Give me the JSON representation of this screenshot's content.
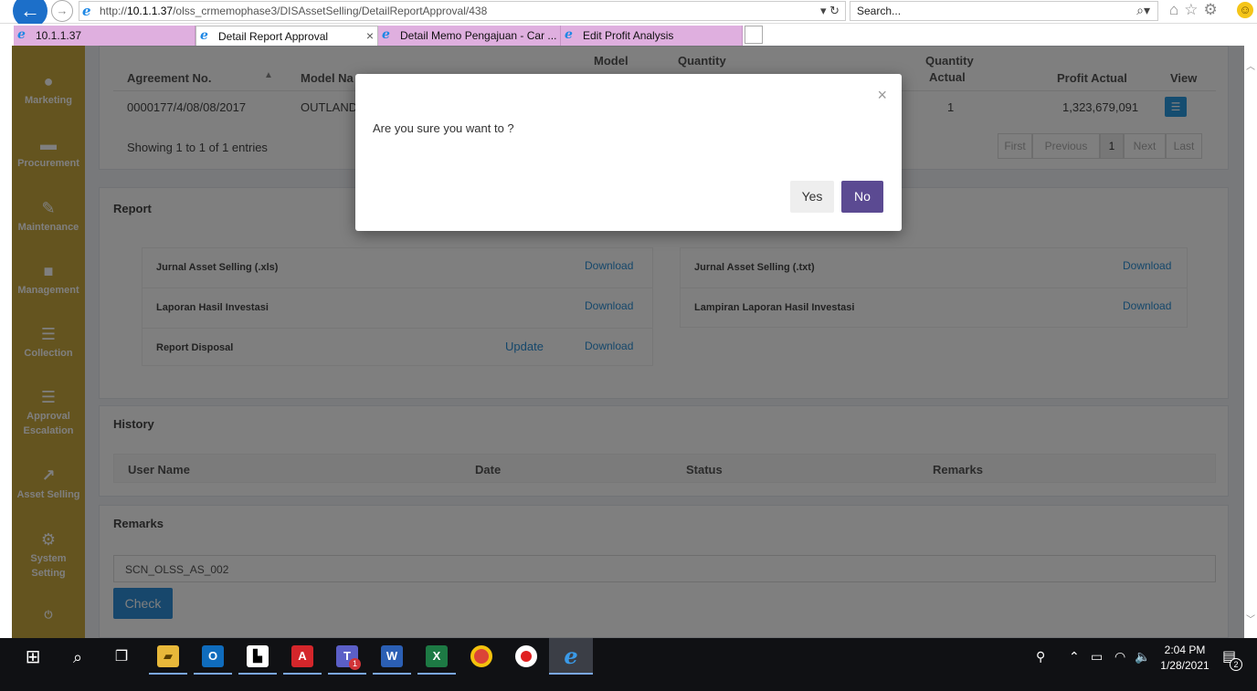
{
  "browser": {
    "url_prefix": "http://",
    "url_host": "10.1.1.37",
    "url_path": "/olss_crmemophase3/DISAssetSelling/DetailReportApproval/438",
    "search_placeholder": "Search...",
    "tabs": [
      {
        "label": "10.1.1.37"
      },
      {
        "label": "Detail Report Approval"
      },
      {
        "label": "Detail Memo Pengajuan - Car ..."
      },
      {
        "label": "Edit Profit Analysis"
      }
    ]
  },
  "sidebar": {
    "items": [
      {
        "label": "Marketing",
        "icon": "globe-icon"
      },
      {
        "label": "Procurement",
        "icon": "cart-icon"
      },
      {
        "label": "Maintenance",
        "icon": "wrench-icon"
      },
      {
        "label": "Management",
        "icon": "truck-icon"
      },
      {
        "label": "Collection",
        "icon": "list-icon"
      },
      {
        "label": "Approval Escalation",
        "icon": "list-icon"
      },
      {
        "label": "Asset Selling",
        "icon": "external-link-icon"
      },
      {
        "label": "System Setting",
        "icon": "gear-icon"
      }
    ]
  },
  "table": {
    "headers": {
      "agreement": "Agreement No.",
      "model_name": "Model Na",
      "model": "Model",
      "quantity": "Quantity",
      "quantity_actual_1": "Quantity",
      "quantity_actual_2": "Actual",
      "profit_actual": "Profit Actual",
      "view": "View"
    },
    "row": {
      "agreement": "0000177/4/08/08/2017",
      "model_name": "OUTLAND",
      "quantity_actual": "1",
      "profit_actual": "1,323,679,091"
    },
    "showing": "Showing 1 to 1 of 1 entries",
    "pager": [
      "First",
      "Previous",
      "1",
      "Next",
      "Last"
    ]
  },
  "report": {
    "title": "Report",
    "left": [
      {
        "label": "Jurnal Asset Selling (.xls)",
        "download": "Download"
      },
      {
        "label": "Laporan Hasil Investasi",
        "download": "Download"
      },
      {
        "label": "Report Disposal",
        "update": "Update",
        "download": "Download"
      }
    ],
    "right": [
      {
        "label": "Jurnal Asset Selling (.txt)",
        "download": "Download"
      },
      {
        "label": "Lampiran Laporan Hasil Investasi",
        "download": "Download"
      }
    ]
  },
  "history": {
    "title": "History",
    "headers": [
      "User Name",
      "Date",
      "Status",
      "Remarks"
    ]
  },
  "remarks": {
    "title": "Remarks",
    "value": "SCN_OLSS_AS_002",
    "check_label": "Check"
  },
  "modal": {
    "close": "×",
    "message": "Are you sure you want to ?",
    "yes": "Yes",
    "no": "No"
  },
  "taskbar": {
    "time": "2:04 PM",
    "date": "1/28/2021",
    "notifications": "2",
    "teams_badge": "1"
  }
}
